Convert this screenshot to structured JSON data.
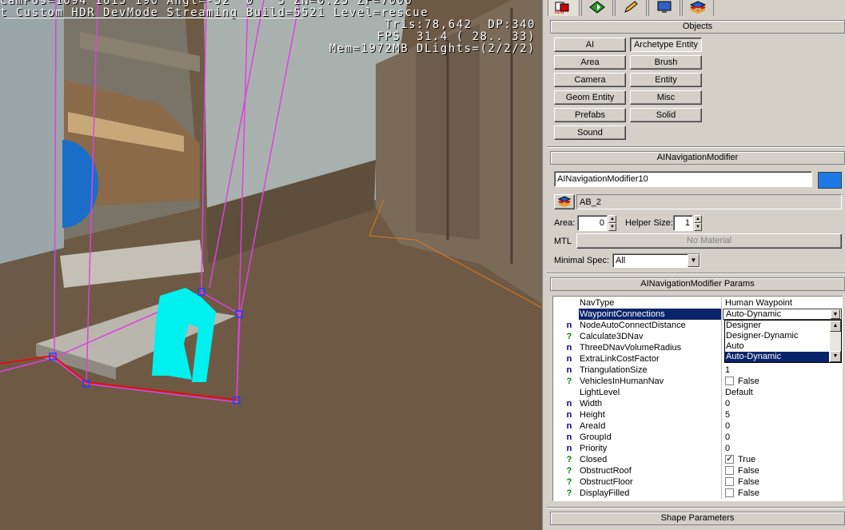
{
  "hud": {
    "line0": "CamPos=1094 1615 190 Angl=-52  0   5 ZN=0.25 ZF=7000",
    "line1": "t Custom HDR DevMode Streaming Build=5521 Level=rescue",
    "line2": "Tris:78,642  DP:340",
    "line3": "FPS  31.4 ( 28.. 33)",
    "line4": "Mem=1972MB DLights=(2/2/2)"
  },
  "top_tabs": [
    {
      "icon": "create-object-icon"
    },
    {
      "icon": "select-object-icon"
    },
    {
      "icon": "pencil-icon"
    },
    {
      "icon": "display-icon"
    },
    {
      "icon": "layers-icon"
    }
  ],
  "objects": {
    "header": "Objects",
    "buttons": [
      "AI",
      "Archetype Entity",
      "Area",
      "Brush",
      "Camera",
      "Entity",
      "Geom Entity",
      "Misc",
      "Prefabs",
      "Solid",
      "Sound"
    ]
  },
  "modifier": {
    "header": "AINavigationModifier",
    "name_value": "AINavigationModifier10",
    "color": "#1e78e6",
    "layer_value": "AB_2",
    "area_label": "Area:",
    "area_value": "0",
    "helper_size_label": "Helper Size:",
    "helper_size_value": "1",
    "mtl_label": "MTL",
    "mtl_button": "No Material",
    "minimal_spec_label": "Minimal Spec:",
    "minimal_spec_value": "All"
  },
  "params": {
    "header": "AINavigationModifier Params",
    "rows": [
      {
        "icon": "",
        "name": "NavType",
        "value": "Human Waypoint",
        "checkbox": false
      },
      {
        "icon": "",
        "name": "WaypointConnections",
        "value": "Auto-Dynamic",
        "checkbox": false
      },
      {
        "icon": "n",
        "name": "NodeAutoConnectDistance",
        "value": "",
        "checkbox": false
      },
      {
        "icon": "?",
        "name": "Calculate3DNav",
        "value": "",
        "checkbox": false
      },
      {
        "icon": "n",
        "name": "ThreeDNavVolumeRadius",
        "value": "",
        "checkbox": false
      },
      {
        "icon": "n",
        "name": "ExtraLinkCostFactor",
        "value": "",
        "checkbox": false
      },
      {
        "icon": "n",
        "name": "TriangulationSize",
        "value": "1",
        "checkbox": false
      },
      {
        "icon": "?",
        "name": "VehiclesInHumanNav",
        "value": "False",
        "checkbox": true,
        "checked": false
      },
      {
        "icon": "",
        "name": "LightLevel",
        "value": "Default",
        "checkbox": false
      },
      {
        "icon": "n",
        "name": "Width",
        "value": "0",
        "checkbox": false
      },
      {
        "icon": "n",
        "name": "Height",
        "value": "5",
        "checkbox": false
      },
      {
        "icon": "n",
        "name": "AreaId",
        "value": "0",
        "checkbox": false
      },
      {
        "icon": "n",
        "name": "GroupId",
        "value": "0",
        "checkbox": false
      },
      {
        "icon": "n",
        "name": "Priority",
        "value": "0",
        "checkbox": false
      },
      {
        "icon": "?",
        "name": "Closed",
        "value": "True",
        "checkbox": true,
        "checked": true
      },
      {
        "icon": "?",
        "name": "ObstructRoof",
        "value": "False",
        "checkbox": true,
        "checked": false
      },
      {
        "icon": "?",
        "name": "ObstructFloor",
        "value": "False",
        "checkbox": true,
        "checked": false
      },
      {
        "icon": "?",
        "name": "DisplayFilled",
        "value": "False",
        "checkbox": true,
        "checked": false
      }
    ],
    "dropdown_options": [
      "Designer",
      "Designer-Dynamic",
      "Auto",
      "Auto-Dynamic"
    ],
    "dropdown_selected": "Auto-Dynamic"
  },
  "shape": {
    "header": "Shape Parameters"
  }
}
